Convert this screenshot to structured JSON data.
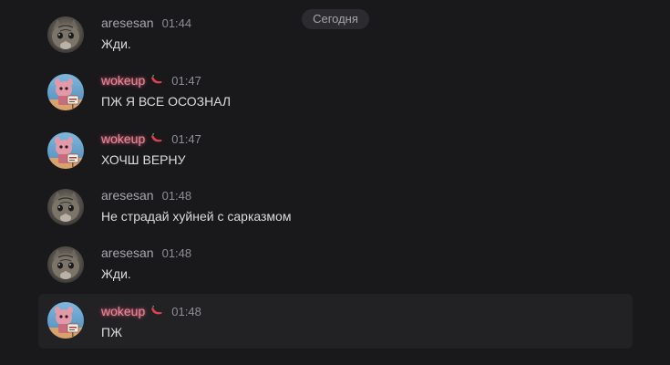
{
  "date_divider": "Сегодня",
  "colors": {
    "background": "#19191c",
    "accent_name": "#e58a9a",
    "name": "#a6a6ad",
    "timestamp": "#8e8e95",
    "message_text": "#dcdcdf",
    "hover_row": "#222225"
  },
  "messages": [
    {
      "author": "aresesan",
      "time": "01:44",
      "text": "Жди.",
      "avatar": "cat-avatar"
    },
    {
      "author": "wokeup",
      "time": "01:47",
      "text": "ПЖ Я ВСЕ ОСОЗНАЛ",
      "avatar": "cartoon-avatar",
      "badge": "chili-pepper-icon"
    },
    {
      "author": "wokeup",
      "time": "01:47",
      "text": "ХОЧШ ВЕРНУ",
      "avatar": "cartoon-avatar",
      "badge": "chili-pepper-icon"
    },
    {
      "author": "aresesan",
      "time": "01:48",
      "text": "Не страдай хуйней с сарказмом",
      "avatar": "cat-avatar"
    },
    {
      "author": "aresesan",
      "time": "01:48",
      "text": "Жди.",
      "avatar": "cat-avatar"
    },
    {
      "author": "wokeup",
      "time": "01:48",
      "text": "ПЖ",
      "avatar": "cartoon-avatar",
      "badge": "chili-pepper-icon"
    }
  ]
}
